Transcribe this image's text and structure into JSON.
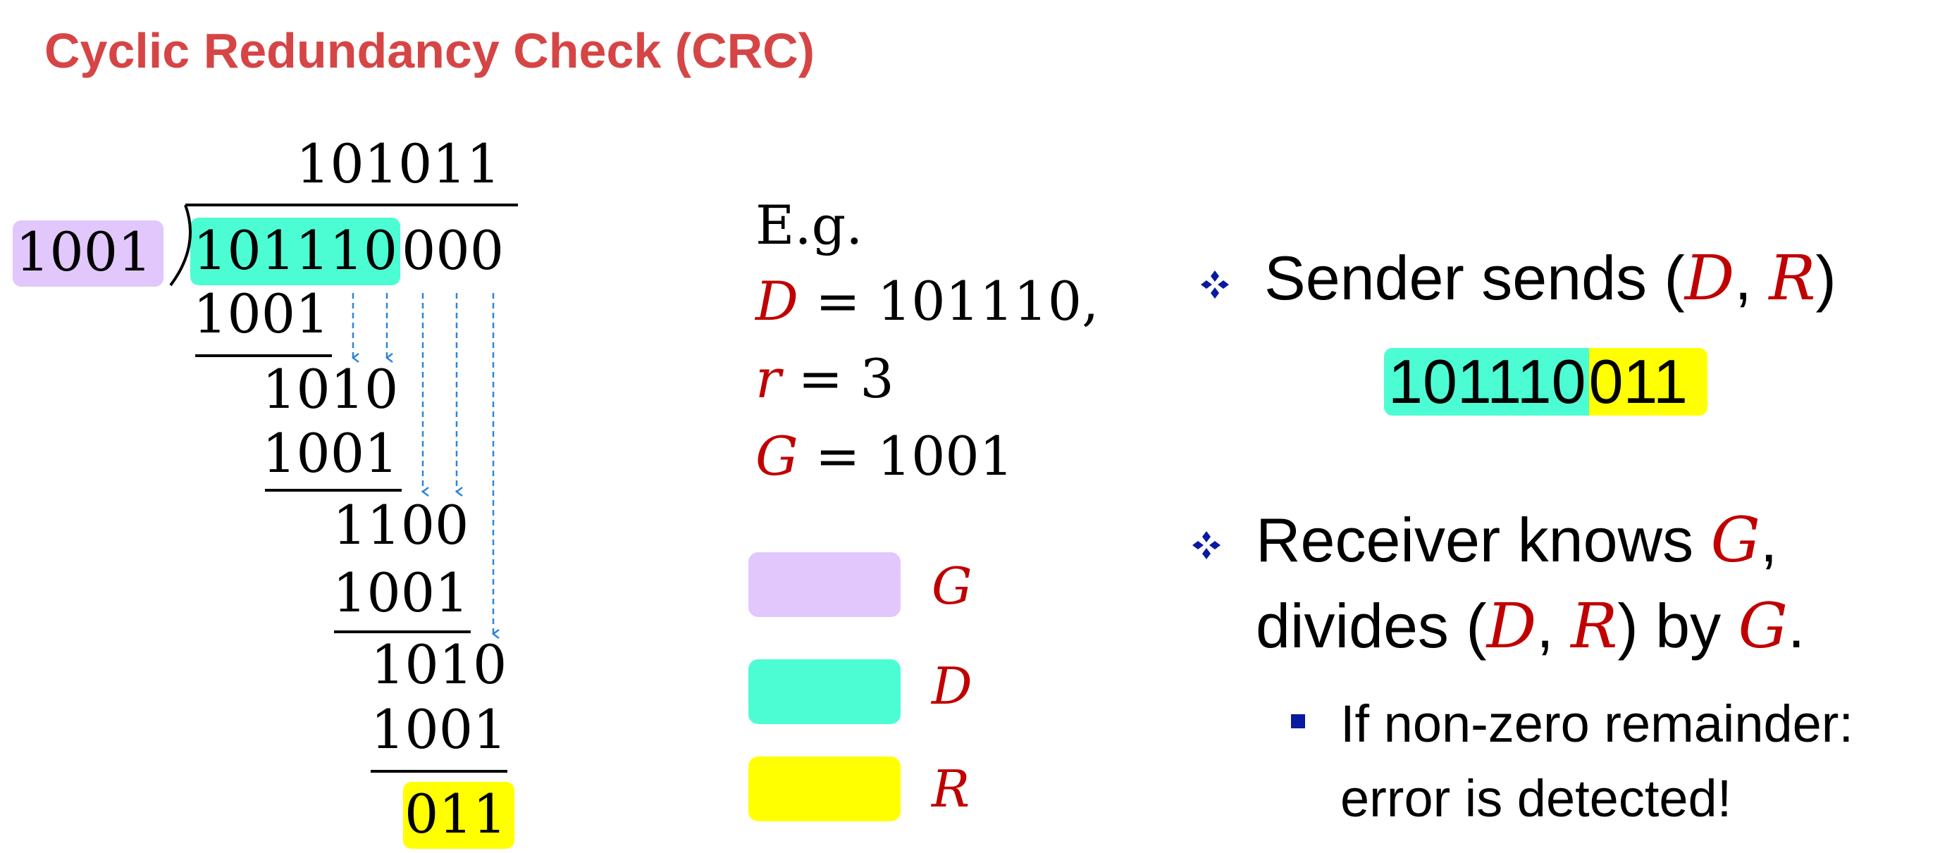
{
  "title": "Cyclic Redundancy Check (CRC)",
  "colors": {
    "title": "#d64545",
    "variable": "#c00000",
    "g_highlight": "#e1c7fb",
    "d_highlight": "#4cfdd4",
    "r_highlight": "#ffff00",
    "arrow": "#2e86d8",
    "bullet": "#0a1aa0"
  },
  "division": {
    "quotient": "101011",
    "divisor": "1001",
    "dividend_data": "101110",
    "dividend_padding": "000",
    "steps": [
      {
        "subtrahend": "1001",
        "result": "1010"
      },
      {
        "subtrahend": "1001",
        "result": "1100"
      },
      {
        "subtrahend": "1001",
        "result": "1010"
      },
      {
        "subtrahend": "1001",
        "result": "011"
      }
    ]
  },
  "example": {
    "heading": "E.g.",
    "lines": [
      {
        "var": "D",
        "value": "= 101110,"
      },
      {
        "var": "r",
        "value": "= 3"
      },
      {
        "var": "G",
        "value": "= 1001"
      }
    ]
  },
  "legend": [
    {
      "label": "G",
      "color": "#e1c7fb"
    },
    {
      "label": "D",
      "color": "#4cfdd4"
    },
    {
      "label": "R",
      "color": "#ffff00"
    }
  ],
  "sender": {
    "bullet_icon": "diamond-bullet-icon",
    "text_before": "Sender sends (",
    "var1": "D",
    "comma": ", ",
    "var2": "R",
    "text_after": ")",
    "codeword_data": "101110",
    "codeword_remainder": "011"
  },
  "receiver": {
    "bullet_icon": "diamond-bullet-icon",
    "line1_text": "Receiver knows ",
    "line1_var": "G",
    "line1_end": ",",
    "line2_text1": "divides (",
    "line2_var1": "D",
    "line2_comma": ", ",
    "line2_var2": "R",
    "line2_text2": ") by ",
    "line2_var3": "G",
    "line2_end": ".",
    "sub_bullet_icon": "square-bullet-icon",
    "sub_line1": "If non-zero remainder:",
    "sub_line2": "error is detected!"
  }
}
